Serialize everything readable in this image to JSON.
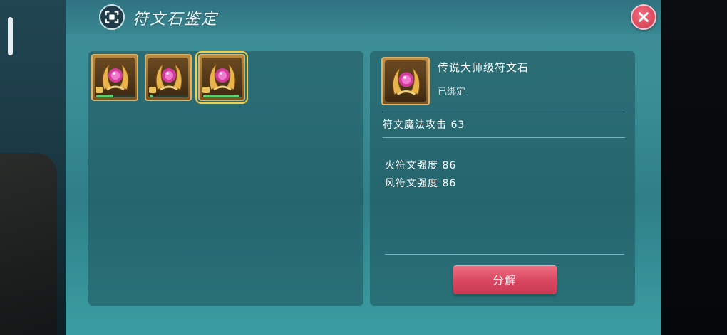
{
  "header": {
    "title": "符文石鉴定"
  },
  "slots": [
    {
      "name": "rune-slot-1",
      "progress": 0.45,
      "locked": true,
      "selected": false
    },
    {
      "name": "rune-slot-2",
      "progress": 0.08,
      "locked": true,
      "selected": false
    },
    {
      "name": "rune-slot-3",
      "progress": 0.95,
      "locked": true,
      "selected": true
    }
  ],
  "detail": {
    "name": "传说大师级符文石",
    "bound_status": "已绑定",
    "main_stat": "符文魔法攻击 63",
    "sub_stats": [
      "火符文强度 86",
      "风符文强度 86"
    ],
    "action_label": "分解"
  },
  "colors": {
    "accent_button": "#d8465f",
    "close_button": "#d23a52",
    "selected_outline": "#f5cf40",
    "progress_fill": "#59d36d"
  },
  "icons": {
    "title": "scan-frame-icon",
    "close": "close-icon",
    "rune": "rune-stone-icon",
    "lock": "lock-icon"
  }
}
